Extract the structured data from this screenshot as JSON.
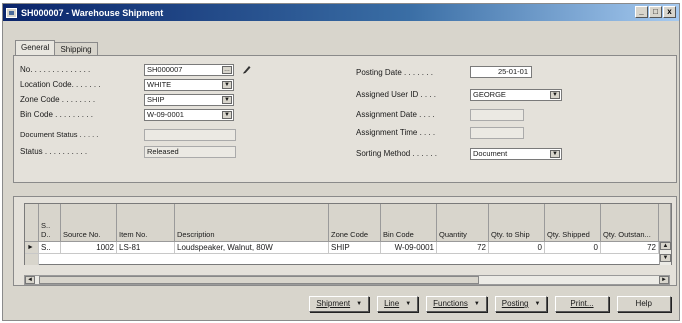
{
  "window": {
    "title": "SH000007 - Warehouse Shipment",
    "minimize": "_",
    "maximize": "□",
    "close": "x"
  },
  "tabs": [
    {
      "label": "General"
    },
    {
      "label": "Shipping"
    }
  ],
  "left_fields": [
    {
      "label": "No. . . . . . . . . . . . . .",
      "value": "SH000007"
    },
    {
      "label": "Location Code. . . . . . .",
      "value": "WHITE"
    },
    {
      "label": "Zone Code . . . . . . . .",
      "value": "SHIP"
    },
    {
      "label": "Bin Code . . . . . . . . .",
      "value": "W-09-0001"
    },
    {
      "label": "Document Status . . . . .",
      "value": ""
    },
    {
      "label": "Status . . . . . . . . . .",
      "value": "Released"
    }
  ],
  "right_fields": [
    {
      "label": "Posting Date . . . . . . .",
      "value": "25-01-01"
    },
    {
      "label": "Assigned User ID . . . .",
      "value": "GEORGE"
    },
    {
      "label": "Assignment Date . . . .",
      "value": ""
    },
    {
      "label": "Assignment Time . . . .",
      "value": ""
    },
    {
      "label": "Sorting Method . . . . . .",
      "value": "Document"
    }
  ],
  "grid": {
    "headers": [
      "S.. D..",
      "Source No.",
      "Item No.",
      "Description",
      "Zone Code",
      "Bin Code",
      "Quantity",
      "Qty. to Ship",
      "Qty. Shipped",
      "Qty. Outstan..."
    ],
    "rows": [
      [
        "S..",
        "1002",
        "LS-81",
        "Loudspeaker, Walnut, 80W",
        "SHIP",
        "W-09-0001",
        "72",
        "0",
        "0",
        "72"
      ]
    ]
  },
  "buttons": {
    "shipment": "Shipment",
    "line": "Line",
    "functions": "Functions",
    "posting": "Posting",
    "print": "Print...",
    "help": "Help"
  }
}
